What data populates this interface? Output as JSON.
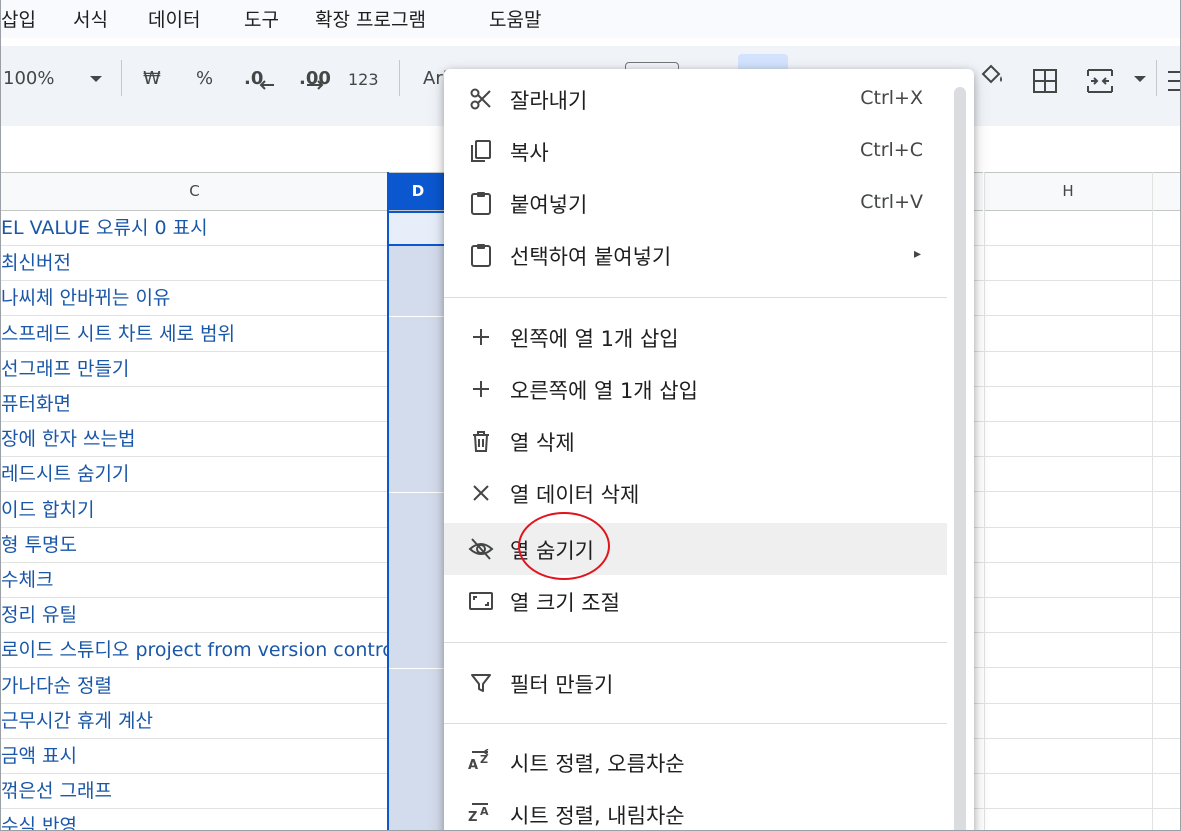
{
  "menubar": {
    "items": [
      "삽입",
      "서식",
      "데이터",
      "도구",
      "확장 프로그램",
      "도움말"
    ]
  },
  "toolbar": {
    "zoom": "100%",
    "currency": "₩",
    "percent": "%",
    "decrease_decimal": ".0",
    "increase_decimal": ".00",
    "number_format": "123",
    "font": "Ari"
  },
  "grid": {
    "columns": {
      "c": "C",
      "d": "D",
      "h": "H"
    },
    "rows": [
      "EL VALUE 오류시 0 표시",
      "최신버전",
      "나씨체 안바뀌는 이유",
      "스프레드 시트 차트 세로 범위",
      "선그래프 만들기",
      "퓨터화면",
      "장에 한자 쓰는법",
      "레드시트 숨기기",
      "이드 합치기",
      "형 투명도",
      "수체크",
      "정리 유틸",
      "로이드 스튜디오 project from version control",
      "가나다순 정렬",
      "근무시간 휴게 계산",
      "금액 표시",
      "꺾은선 그래프",
      "수식 반영"
    ]
  },
  "context_menu": {
    "cut": {
      "label": "잘라내기",
      "shortcut": "Ctrl+X"
    },
    "copy": {
      "label": "복사",
      "shortcut": "Ctrl+C"
    },
    "paste": {
      "label": "붙여넣기",
      "shortcut": "Ctrl+V"
    },
    "paste_special": {
      "label": "선택하여 붙여넣기",
      "arrow": "▸"
    },
    "insert_left": {
      "label": "왼쪽에 열 1개 삽입"
    },
    "insert_right": {
      "label": "오른쪽에 열 1개 삽입"
    },
    "delete_column": {
      "label": "열 삭제"
    },
    "clear_column": {
      "label": "열 데이터 삭제"
    },
    "hide_column": {
      "label": "열 숨기기"
    },
    "resize_column": {
      "label": "열 크기 조절"
    },
    "create_filter": {
      "label": "필터 만들기"
    },
    "sort_asc": {
      "label": "시트 정렬, 오름차순"
    },
    "sort_desc": {
      "label": "시트 정렬, 내림차순"
    }
  },
  "colors": {
    "selected_header": "#0b57d0",
    "link_text": "#1a57a8",
    "annotation_circle": "#e0141c"
  }
}
